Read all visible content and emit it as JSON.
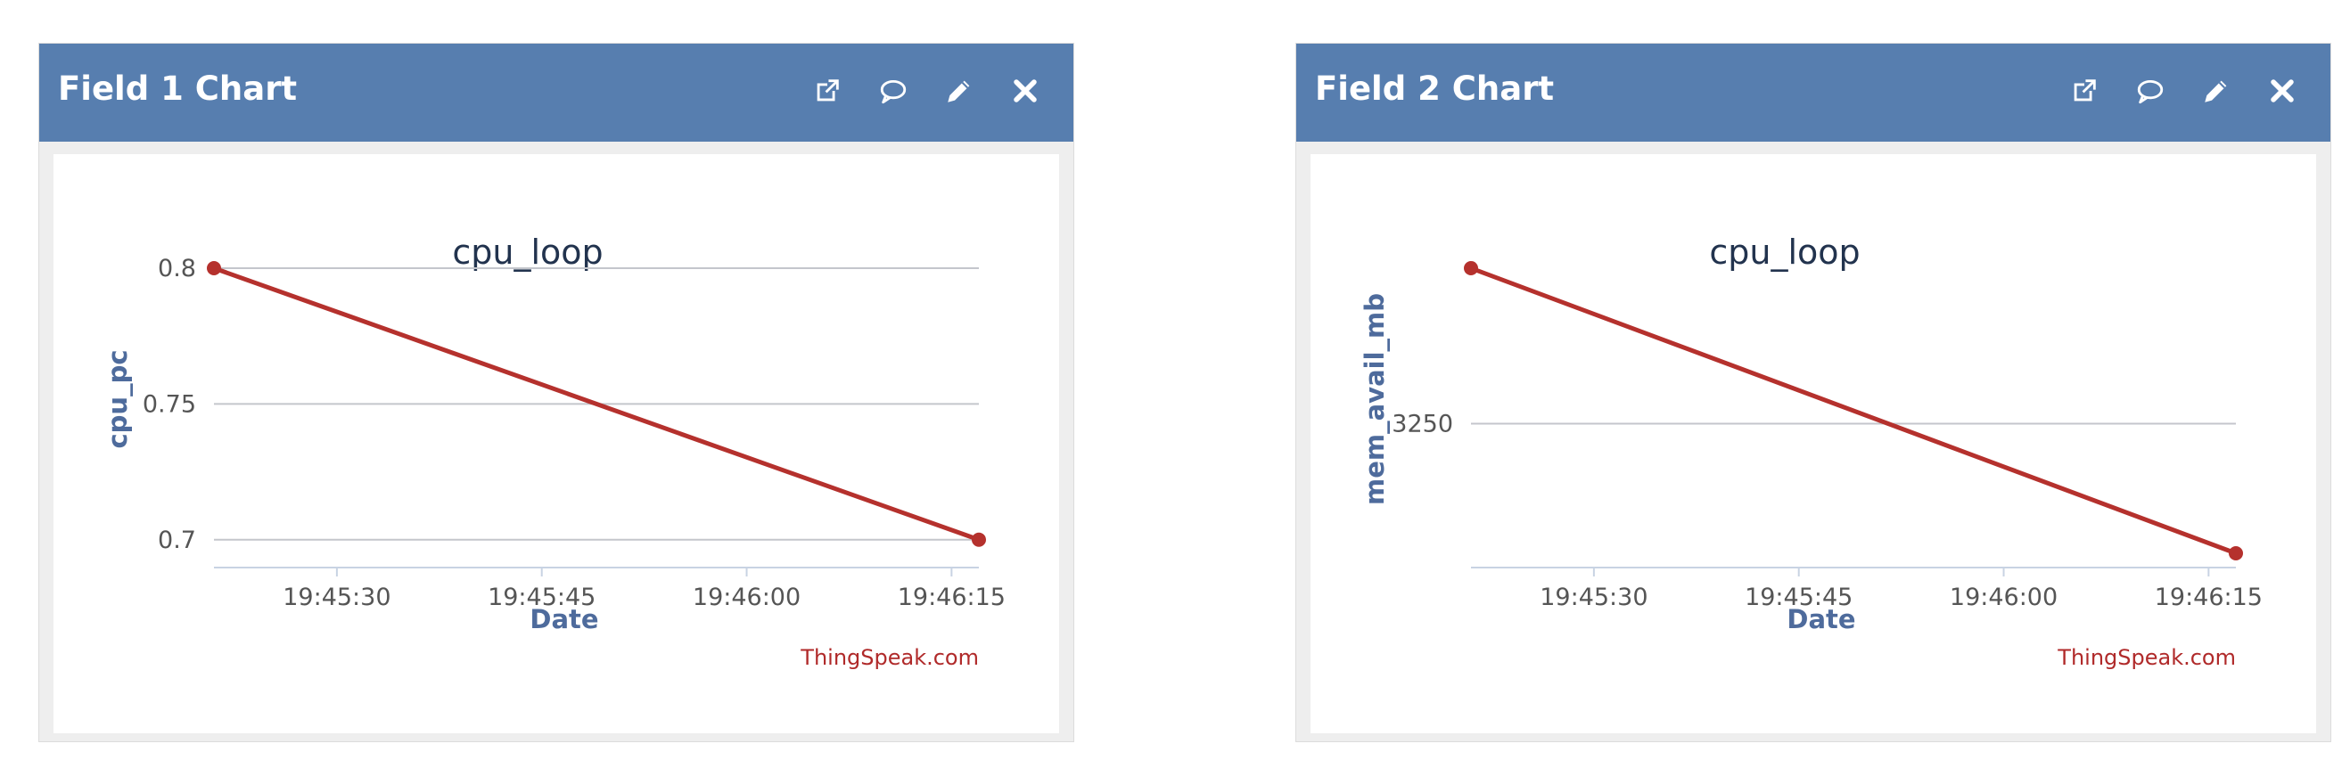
{
  "widgets": [
    {
      "title": "Field 1 Chart",
      "icons": [
        "external-link-icon",
        "comment-icon",
        "pencil-icon",
        "close-icon"
      ]
    },
    {
      "title": "Field 2 Chart",
      "icons": [
        "external-link-icon",
        "comment-icon",
        "pencil-icon",
        "close-icon"
      ]
    }
  ],
  "credit": "ThingSpeak.com",
  "chart_data": [
    {
      "type": "line",
      "title": "cpu_loop",
      "xlabel": "Date",
      "ylabel": "cpu_pc",
      "x": [
        "19:45:21",
        "19:46:17"
      ],
      "xticks": [
        "19:45:30",
        "19:45:45",
        "19:46:00",
        "19:46:15"
      ],
      "xlim": [
        "19:45:21",
        "19:46:17"
      ],
      "yticks": [
        "0.8",
        "0.75",
        "0.7"
      ],
      "ylim": [
        0.695,
        0.8
      ],
      "series": [
        {
          "values": [
            0.8,
            0.7
          ]
        }
      ],
      "color": "#b5312d",
      "grid": true
    },
    {
      "type": "line",
      "title": "cpu_loop",
      "xlabel": "Date",
      "ylabel": "mem_avail_mb",
      "x": [
        "19:45:21",
        "19:46:17"
      ],
      "xticks": [
        "19:45:30",
        "19:45:45",
        "19:46:00",
        "19:46:15"
      ],
      "xlim": [
        "19:45:21",
        "19:46:17"
      ],
      "yticks": [
        "3250"
      ],
      "ylim": [
        3200,
        3310
      ],
      "series": [
        {
          "values": [
            3310,
            3200
          ]
        }
      ],
      "color": "#b5312d",
      "grid": true
    }
  ]
}
